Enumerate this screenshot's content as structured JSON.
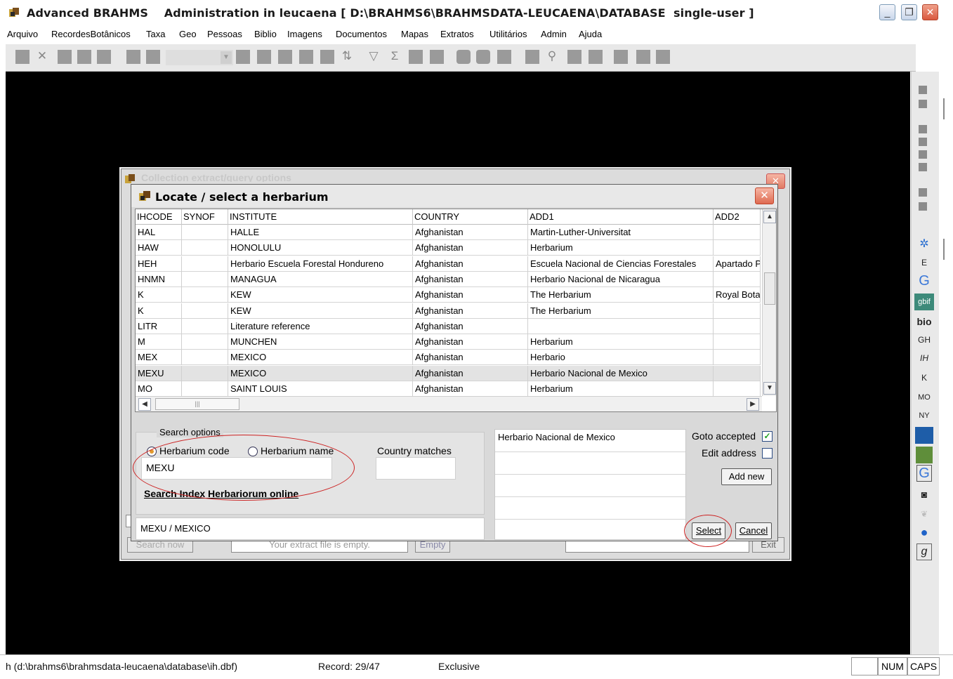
{
  "window": {
    "title": "Advanced BRAHMS    Administration in leucaena [ D:\\BRAHMS6\\BRAHMSDATA-LEUCAENA\\DATABASE  single-user ]",
    "minimize_glyph": "_",
    "restore_glyph": "❐",
    "close_glyph": "✕"
  },
  "menu": [
    "Arquivo",
    "RecordesBotânicos",
    "Taxa",
    "Geo",
    "Pessoas",
    "Biblio",
    "Imagens",
    "Documentos",
    "Mapas",
    "Extratos",
    "Utilitários",
    "Admin",
    "Ajuda"
  ],
  "toolbar": {
    "glyphs": [
      "✕",
      "⇅",
      "▽",
      "Σ",
      "⚲"
    ]
  },
  "side_panel": {
    "labels": [
      "E",
      "G",
      "gbif",
      "bio",
      "GH",
      "IH",
      "K",
      "MO",
      "NY",
      "G",
      "g"
    ]
  },
  "status": {
    "path": "h (d:\\brahms6\\brahmsdata-leucaena\\database\\ih.dbf)",
    "record": "Record: 29/47",
    "mode": "Exclusive",
    "num": "NUM",
    "caps": "CAPS"
  },
  "background_dialog": {
    "title": "Collection extract/query options",
    "search_now": "Search now",
    "message": "Your extract file is empty.",
    "empty": "Empty",
    "exit": "Exit"
  },
  "dialog": {
    "title": "Locate / select a herbarium",
    "close_glyph": "✕",
    "columns": [
      "IHCODE",
      "SYNOF",
      "INSTITUTE",
      "COUNTRY",
      "ADD1",
      "ADD2"
    ],
    "rows": [
      {
        "code": "HAL",
        "synof": "",
        "institute": "HALLE",
        "country": "Afghanistan",
        "add1": "Martin-Luther-Universitat",
        "add2": ""
      },
      {
        "code": "HAW",
        "synof": "",
        "institute": "HONOLULU",
        "country": "Afghanistan",
        "add1": "Herbarium",
        "add2": ""
      },
      {
        "code": "HEH",
        "synof": "",
        "institute": "Herbario Escuela Forestal Hondureno",
        "country": "Afghanistan",
        "add1": "Escuela Nacional de Ciencias Forestales",
        "add2": "Apartado P"
      },
      {
        "code": "HNMN",
        "synof": "",
        "institute": "MANAGUA",
        "country": "Afghanistan",
        "add1": "Herbario Nacional de Nicaragua",
        "add2": ""
      },
      {
        "code": "K",
        "synof": "",
        "institute": "KEW",
        "country": "Afghanistan",
        "add1": "The Herbarium",
        "add2": "Royal Bota"
      },
      {
        "code": "K",
        "synof": "",
        "institute": "KEW",
        "country": "Afghanistan",
        "add1": "The Herbarium",
        "add2": ""
      },
      {
        "code": "LITR",
        "synof": "",
        "institute": "Literature reference",
        "country": "Afghanistan",
        "add1": "",
        "add2": ""
      },
      {
        "code": "M",
        "synof": "",
        "institute": "MUNCHEN",
        "country": "Afghanistan",
        "add1": "Herbarium",
        "add2": ""
      },
      {
        "code": "MEX",
        "synof": "",
        "institute": "MEXICO",
        "country": "Afghanistan",
        "add1": "Herbario",
        "add2": ""
      },
      {
        "code": "MEXU",
        "synof": "",
        "institute": "MEXICO",
        "country": "Afghanistan",
        "add1": "Herbario Nacional de Mexico",
        "add2": ""
      },
      {
        "code": "MO",
        "synof": "",
        "institute": "SAINT LOUIS",
        "country": "Afghanistan",
        "add1": "Herbarium",
        "add2": ""
      }
    ],
    "selected_row": 9,
    "search_options_label": "Search options",
    "radio_code": "Herbarium code",
    "radio_name": "Herbarium name",
    "search_value": "MEXU",
    "country_matches": "Country matches",
    "country_value": "",
    "online_link": "Search Index Herbariorum online",
    "result": "MEXU / MEXICO",
    "address_lines": [
      "Herbario Nacional de Mexico",
      "",
      "",
      "",
      ""
    ],
    "goto_accepted": "Goto accepted",
    "edit_address": "Edit address",
    "add_new": "Add new",
    "select": "Select",
    "cancel": "Cancel"
  }
}
